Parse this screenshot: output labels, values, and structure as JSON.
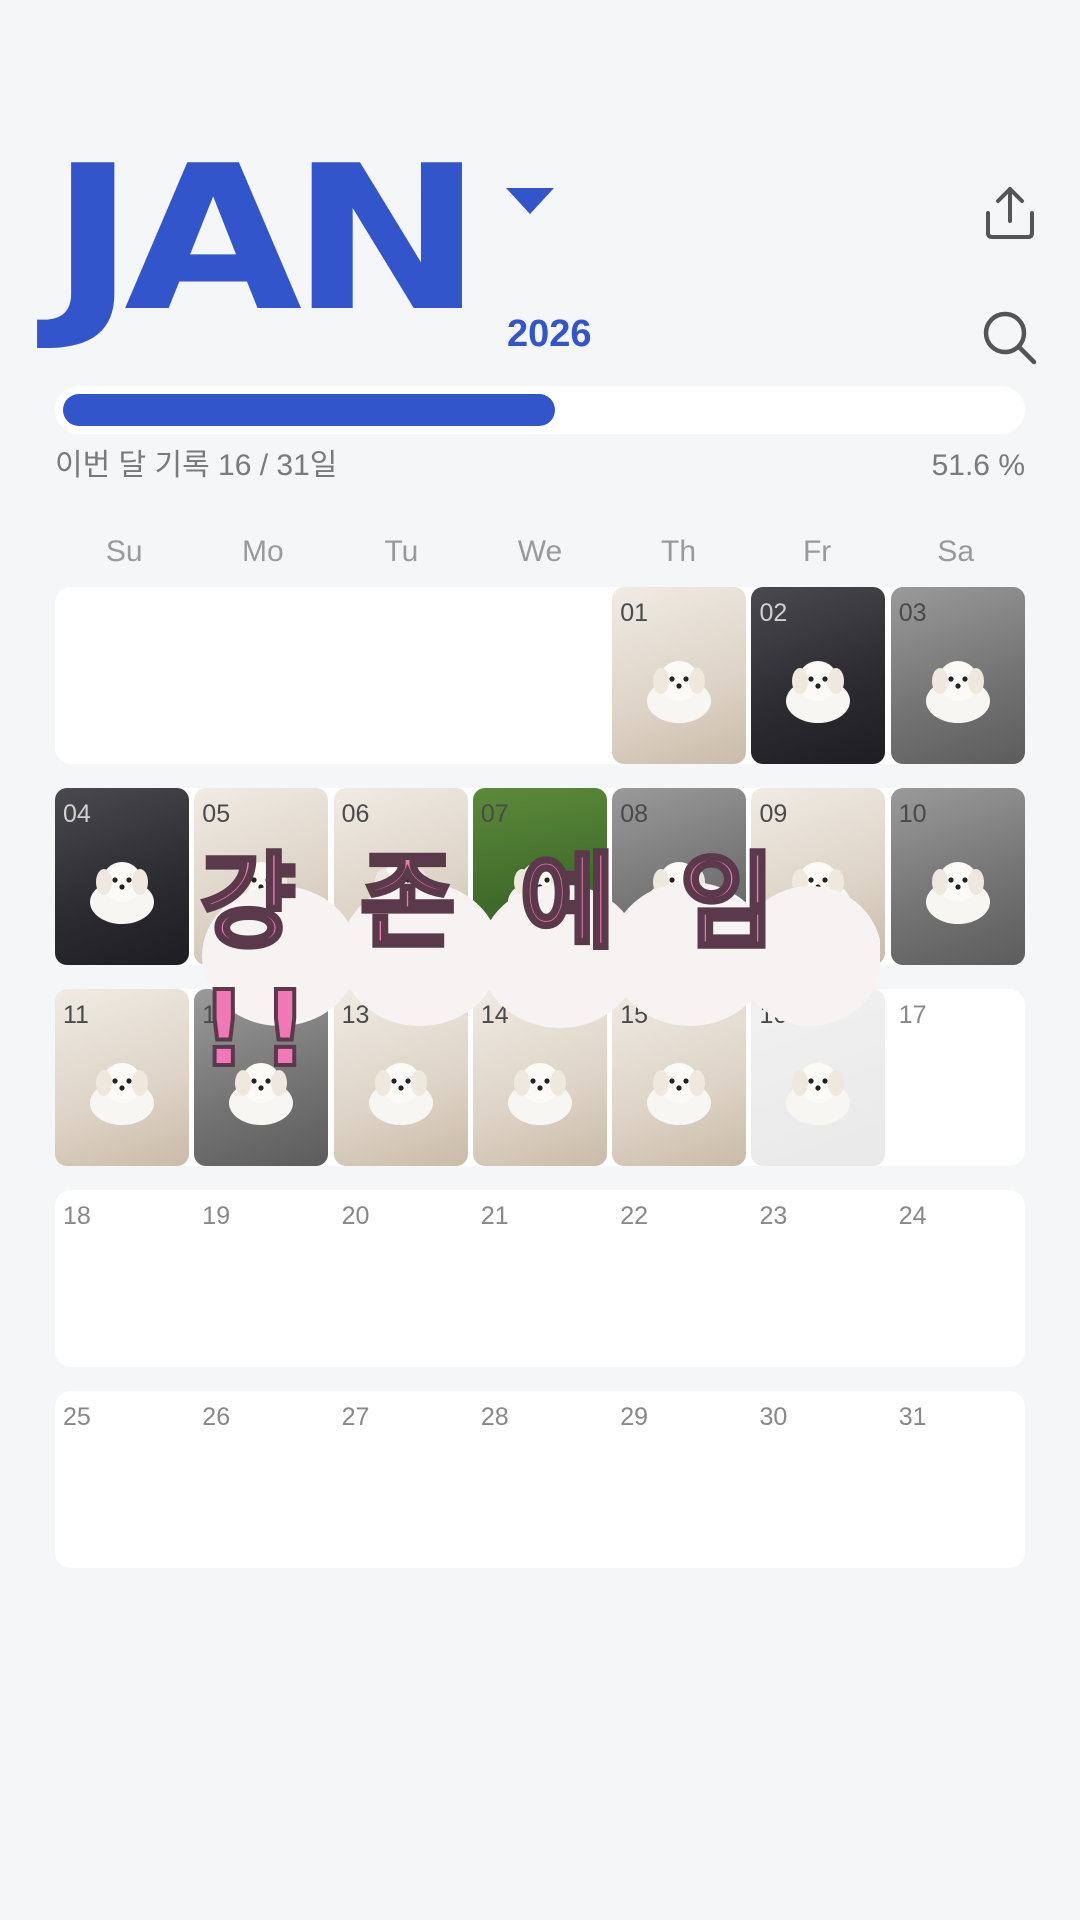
{
  "header": {
    "month": "JAN",
    "year": "2026"
  },
  "colors": {
    "accent": "#3355cc",
    "progress_fill": "#3355cc",
    "background": "#f4f6f8",
    "sticker_pink": "#f078b4"
  },
  "icons": {
    "dropdown": "triangle-down-icon",
    "share": "share-icon",
    "search": "search-icon"
  },
  "progress": {
    "label": "이번 달 기록 16 / 31일",
    "percent_text": "51.6 %",
    "fraction": 0.516
  },
  "weekdays": [
    "Su",
    "Mo",
    "Tu",
    "We",
    "Th",
    "Fr",
    "Sa"
  ],
  "days": [
    {
      "label": ""
    },
    {
      "label": ""
    },
    {
      "label": ""
    },
    {
      "label": ""
    },
    {
      "label": "01",
      "photo": true,
      "tone": "light"
    },
    {
      "label": "02",
      "photo": true,
      "tone": "dark"
    },
    {
      "label": "03",
      "photo": true,
      "tone": "gray"
    },
    {
      "label": "04",
      "photo": true,
      "tone": "dark"
    },
    {
      "label": "05",
      "photo": true,
      "tone": "light"
    },
    {
      "label": "06",
      "photo": true,
      "tone": "light"
    },
    {
      "label": "07",
      "photo": true,
      "tone": "grass"
    },
    {
      "label": "08",
      "photo": true,
      "tone": "gray"
    },
    {
      "label": "09",
      "photo": true,
      "tone": "light"
    },
    {
      "label": "10",
      "photo": true,
      "tone": "gray"
    },
    {
      "label": "11",
      "photo": true,
      "tone": "light"
    },
    {
      "label": "12",
      "photo": true,
      "tone": "gray"
    },
    {
      "label": "13",
      "photo": true,
      "tone": "light"
    },
    {
      "label": "14",
      "photo": true,
      "tone": "light"
    },
    {
      "label": "15",
      "photo": true,
      "tone": "light"
    },
    {
      "label": "16",
      "photo": true,
      "tone": "faded"
    },
    {
      "label": "17"
    },
    {
      "label": "18"
    },
    {
      "label": "19"
    },
    {
      "label": "20"
    },
    {
      "label": "21"
    },
    {
      "label": "22"
    },
    {
      "label": "23"
    },
    {
      "label": "24"
    },
    {
      "label": "25"
    },
    {
      "label": "26"
    },
    {
      "label": "27"
    },
    {
      "label": "28"
    },
    {
      "label": "29"
    },
    {
      "label": "30"
    },
    {
      "label": "31"
    }
  ],
  "sticker": {
    "text": "걍 존 예 임 !!"
  }
}
